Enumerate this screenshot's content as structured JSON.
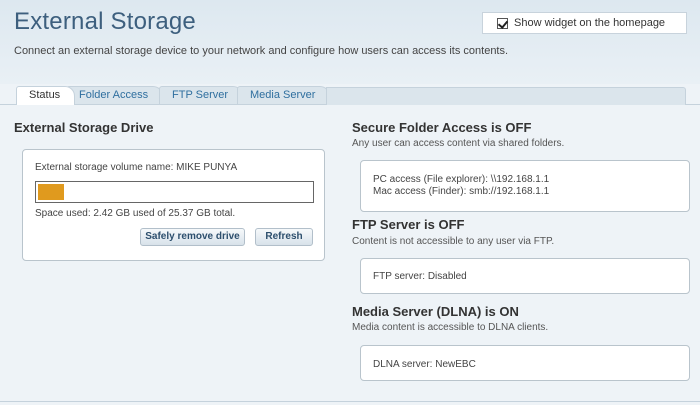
{
  "header": {
    "title": "External Storage",
    "description": "Connect an external storage device to your network and configure how users can access its contents.",
    "widget_checkbox_label": "Show widget on the homepage",
    "widget_checked": true
  },
  "tabs": [
    {
      "label": "Status",
      "active": true
    },
    {
      "label": "Folder Access",
      "active": false
    },
    {
      "label": "FTP Server",
      "active": false
    },
    {
      "label": "Media Server",
      "active": false
    }
  ],
  "drive": {
    "heading": "External Storage Drive",
    "volume_name": "External storage volume name: MIKE PUNYA",
    "used_fraction": 0.095,
    "space_used": "Space used: 2.42 GB used of 25.37 GB total.",
    "remove_button": "Safely remove drive",
    "refresh_button": "Refresh"
  },
  "secure_folder": {
    "heading": "Secure Folder Access is OFF",
    "subtitle": "Any user can access content via shared folders.",
    "pc_access": "PC access (File explorer): \\\\192.168.1.1",
    "mac_access": "Mac access (Finder): smb://192.168.1.1"
  },
  "ftp": {
    "heading": "FTP Server is OFF",
    "subtitle": "Content is not accessible to any user via FTP.",
    "status": "FTP server: Disabled"
  },
  "media": {
    "heading": "Media Server (DLNA) is ON",
    "subtitle": "Media content is accessible to DLNA clients.",
    "status": "DLNA server: NewEBC"
  },
  "colors": {
    "accent": "#3d5f7e",
    "link": "#2f6f9f",
    "progress": "#e09a1e"
  }
}
